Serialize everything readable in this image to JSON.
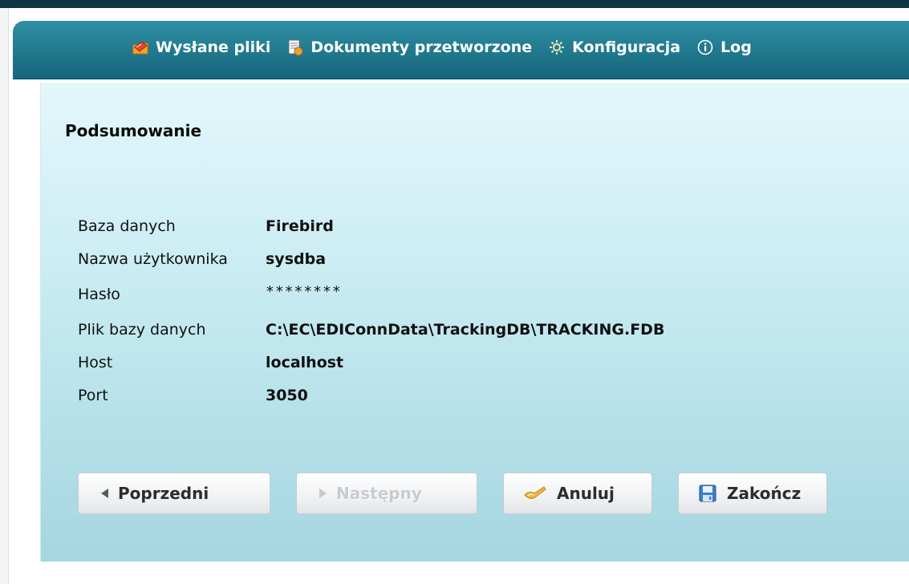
{
  "nav": {
    "items": [
      {
        "label": "Wysłane pliki",
        "icon": "sent-files-icon"
      },
      {
        "label": "Dokumenty przetworzone",
        "icon": "processed-documents-icon"
      },
      {
        "label": "Konfiguracja",
        "icon": "gear-icon"
      },
      {
        "label": "Log",
        "icon": "info-icon"
      }
    ]
  },
  "summary": {
    "title": "Podsumowanie",
    "rows": [
      {
        "label": "Baza danych",
        "value": "Firebird"
      },
      {
        "label": "Nazwa użytkownika",
        "value": "sysdba"
      },
      {
        "label": "Hasło",
        "value": "********"
      },
      {
        "label": "Plik bazy danych",
        "value": "C:\\EC\\EDIConnData\\TrackingDB\\TRACKING.FDB"
      },
      {
        "label": "Host",
        "value": "localhost"
      },
      {
        "label": "Port",
        "value": "3050"
      }
    ]
  },
  "buttons": {
    "prev": "Poprzedni",
    "next": "Następny",
    "cancel": "Anuluj",
    "finish": "Zakończ"
  },
  "colors": {
    "nav_bar": "#237c91",
    "content_top": "#e4f7fb",
    "content_bottom": "#a5d6e1",
    "disabled_text": "#c8ccd0"
  }
}
